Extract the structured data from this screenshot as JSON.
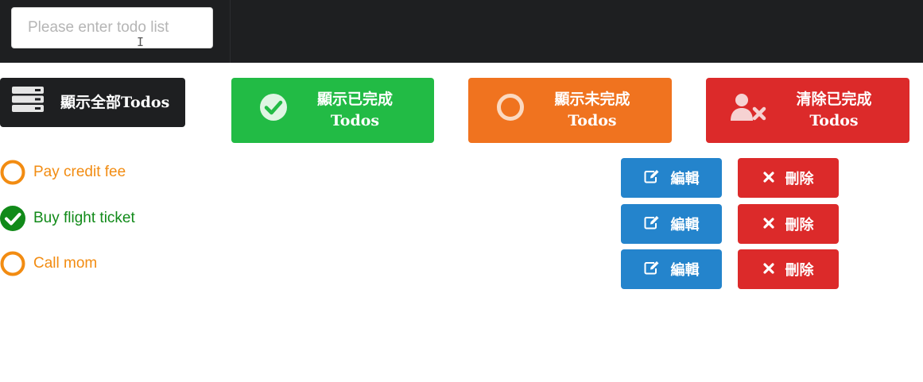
{
  "input": {
    "placeholder": "Please enter todo list"
  },
  "filters": {
    "all": {
      "label": "顯示全部Todos",
      "icon": "server-stack-icon"
    },
    "completed": {
      "label": "顯示已完成 Todos",
      "icon": "check-circle-icon",
      "color": "#22bb45"
    },
    "uncompleted": {
      "label": "顯示未完成 Todos",
      "icon": "circle-outline-icon",
      "color": "#f0731f"
    },
    "clear_completed": {
      "label": "清除已完成 Todos",
      "icon": "user-remove-icon",
      "color": "#dc2a2a"
    }
  },
  "todos": [
    {
      "text": "Pay credit fee",
      "done": false,
      "color": "#f28c12"
    },
    {
      "text": "Buy flight ticket",
      "done": true,
      "color": "#118a19"
    },
    {
      "text": "Call mom",
      "done": false,
      "color": "#f28c12"
    }
  ],
  "actions": {
    "edit_label": "編輯",
    "delete_label": "刪除",
    "edit_color": "#2484cc",
    "delete_color": "#dc2a2a"
  }
}
